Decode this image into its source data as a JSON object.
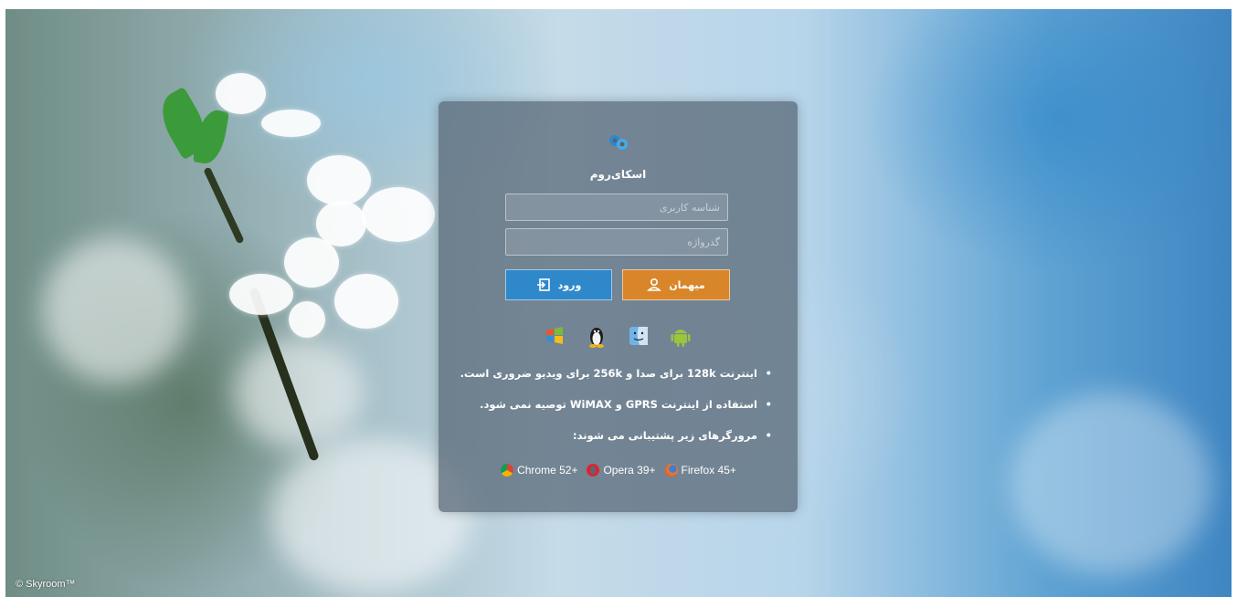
{
  "app": {
    "title": "اسکای‌روم"
  },
  "login": {
    "username_placeholder": "شناسه کاربری",
    "password_placeholder": "گذرواژه",
    "login_label": "ورود",
    "guest_label": "میهمان"
  },
  "platforms": [
    "windows-icon",
    "linux-icon",
    "macos-icon",
    "android-icon"
  ],
  "notes": [
    "اینترنت 128k برای صدا و 256k برای ویدیو ضروری است.",
    "استفاده از اینترنت GPRS و WiMAX توصیه نمی شود.",
    "مرورگرهای زیر پشتیبانی می شوند:"
  ],
  "browsers": [
    {
      "name": "Chrome 52+",
      "icon": "chrome-icon"
    },
    {
      "name": "Opera 39+",
      "icon": "opera-icon"
    },
    {
      "name": "Firefox 45+",
      "icon": "firefox-icon"
    }
  ],
  "footer": {
    "copyright": "© Skyroom™"
  },
  "colors": {
    "login_button": "#2e88c9",
    "guest_button": "#d9862a",
    "card": "#55646f"
  }
}
